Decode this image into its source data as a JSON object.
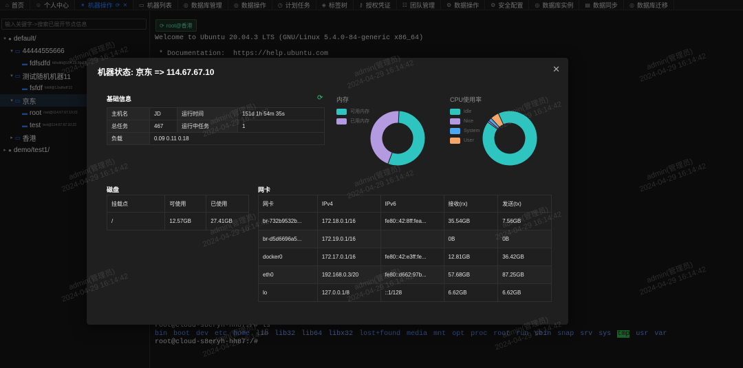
{
  "tabs": [
    {
      "icon": "home-icon",
      "glyph": "⌂",
      "label": "首页"
    },
    {
      "icon": "user-icon",
      "glyph": "☺",
      "label": "个人中心"
    },
    {
      "icon": "terminal-icon",
      "glyph": "✶",
      "label": "机器操作",
      "active": true
    },
    {
      "icon": "monitor-icon",
      "glyph": "▭",
      "label": "机器列表"
    },
    {
      "icon": "database-icon",
      "glyph": "◎",
      "label": "数据库管理"
    },
    {
      "icon": "database-icon",
      "glyph": "◎",
      "label": "数据操作"
    },
    {
      "icon": "clock-icon",
      "glyph": "◷",
      "label": "计划任务"
    },
    {
      "icon": "tag-icon",
      "glyph": "◈",
      "label": "标签树"
    },
    {
      "icon": "key-icon",
      "glyph": "⚷",
      "label": "授权凭证"
    },
    {
      "icon": "team-icon",
      "glyph": "☷",
      "label": "团队管理"
    },
    {
      "icon": "ops-icon",
      "glyph": "⚙",
      "label": "数据操作"
    },
    {
      "icon": "security-icon",
      "glyph": "⚙",
      "label": "安全配置"
    },
    {
      "icon": "database-icon",
      "glyph": "◎",
      "label": "数据库实例"
    },
    {
      "icon": "sync-icon",
      "glyph": "▤",
      "label": "数据同步"
    },
    {
      "icon": "migrate-icon",
      "glyph": "◎",
      "label": "数据库迁移"
    }
  ],
  "sidebar": {
    "search_placeholder": "输入关键字->搜索已展开节点信息",
    "tree": [
      {
        "level": 0,
        "caret": "▾",
        "kind": "group",
        "label": "default/",
        "sub": ""
      },
      {
        "level": 1,
        "caret": "▾",
        "kind": "machine",
        "label": "44444555666",
        "sub": ""
      },
      {
        "level": 2,
        "caret": "",
        "kind": "host",
        "label": "fdfsdfd",
        "sub": "fdfsdfd@154.29.90.83"
      },
      {
        "level": 1,
        "caret": "▾",
        "kind": "machine",
        "label": "测试随机机器11",
        "sub": ""
      },
      {
        "level": 2,
        "caret": "",
        "kind": "host",
        "label": "fsfdf",
        "sub": "fsfdf@12sdfsdf:22"
      },
      {
        "level": 1,
        "caret": "▾",
        "kind": "machine",
        "label": "京东",
        "sub": "",
        "selected": true
      },
      {
        "level": 2,
        "caret": "",
        "kind": "host",
        "label": "root",
        "sub": "root@114.67.67.10:22"
      },
      {
        "level": 2,
        "caret": "",
        "kind": "host",
        "label": "test",
        "sub": "test@114.67.67.10:22"
      },
      {
        "level": 1,
        "caret": "▸",
        "kind": "machine",
        "label": "香港",
        "sub": ""
      },
      {
        "level": 0,
        "caret": "▸",
        "kind": "group",
        "label": "demo/test1/",
        "sub": ""
      }
    ]
  },
  "terminal": {
    "tab_label": "root@香港",
    "welcome": "Welcome to Ubuntu 20.04.3 LTS (GNU/Linux 5.4.0-84-generic x86_64)",
    "doc_line": " * Documentation:  https://help.ubuntu.com",
    "prompt_cmd": "root@cloud-s8eryh-hh87:/# ls",
    "ls_items": [
      {
        "t": "bin",
        "c": "d"
      },
      {
        "t": "boot",
        "c": "d"
      },
      {
        "t": "dev",
        "c": "d"
      },
      {
        "t": "etc",
        "c": "d"
      },
      {
        "t": "home",
        "c": "d"
      },
      {
        "t": "lib",
        "c": "dn"
      },
      {
        "t": "lib32",
        "c": "dn"
      },
      {
        "t": "lib64",
        "c": "dn"
      },
      {
        "t": "libx32",
        "c": "dn"
      },
      {
        "t": "lost+found",
        "c": "d"
      },
      {
        "t": "media",
        "c": "d"
      },
      {
        "t": "mnt",
        "c": "d"
      },
      {
        "t": "opt",
        "c": "d"
      },
      {
        "t": "proc",
        "c": "d"
      },
      {
        "t": "root",
        "c": "d"
      },
      {
        "t": "run",
        "c": "d"
      },
      {
        "t": "sbin",
        "c": "dn"
      },
      {
        "t": "snap",
        "c": "d"
      },
      {
        "t": "srv",
        "c": "d"
      },
      {
        "t": "sys",
        "c": "d"
      },
      {
        "t": "tmp",
        "c": "hl"
      },
      {
        "t": "usr",
        "c": "d"
      },
      {
        "t": "var",
        "c": "d"
      }
    ],
    "prompt": "root@cloud-s8eryh-hh87:/#"
  },
  "modal": {
    "title": "机器状态: 京东 => 114.67.67.10",
    "basic": {
      "title": "基础信息",
      "hostname_label": "主机名",
      "hostname": "JD",
      "uptime_label": "运行时间",
      "uptime": "151d 1h 54m 35s",
      "tasks_label": "总任务",
      "tasks": "467",
      "running_label": "运行中任务",
      "running": "1",
      "load_label": "负载",
      "load": "0.09 0.11 0.18"
    },
    "memory": {
      "title": "内存",
      "legend": [
        {
          "label": "可用内存",
          "color": "#2ec4c0"
        },
        {
          "label": "已用内存",
          "color": "#b49ae0"
        }
      ],
      "values": [
        55,
        45
      ]
    },
    "cpu": {
      "title": "CPU使用率",
      "legend": [
        {
          "label": "Idle",
          "color": "#2ec4c0"
        },
        {
          "label": "Nice",
          "color": "#b49ae0"
        },
        {
          "label": "System",
          "color": "#4ea8f0"
        },
        {
          "label": "User",
          "color": "#f5a66a"
        }
      ],
      "values": [
        92,
        1,
        2,
        5
      ]
    },
    "disk": {
      "title": "磁盘",
      "headers": [
        "挂载点",
        "可使用",
        "已使用"
      ],
      "rows": [
        [
          "/",
          "12.57GB",
          "27.41GB"
        ]
      ]
    },
    "nic": {
      "title": "网卡",
      "headers": [
        "网卡",
        "IPv4",
        "IPv6",
        "接收(rx)",
        "发送(tx)"
      ],
      "rows": [
        [
          "br-732b9532b...",
          "172.18.0.1/16",
          "fe80::42:8ff:fea...",
          "35.54GB",
          "7.56GB"
        ],
        [
          "br-d5d6696a5...",
          "172.19.0.1/16",
          "",
          "0B",
          "0B"
        ],
        [
          "docker0",
          "172.17.0.1/16",
          "fe80::42:e3ff:fe...",
          "12.81GB",
          "36.42GB"
        ],
        [
          "eth0",
          "192.168.0.3/20",
          "fe80::d662:97b...",
          "57.68GB",
          "87.25GB"
        ],
        [
          "lo",
          "127.0.0.1/8",
          "::1/128",
          "6.62GB",
          "6.62GB"
        ]
      ]
    }
  },
  "watermark": {
    "user": "admin(管理员)",
    "time": "2024-04-29 16:14:42"
  }
}
